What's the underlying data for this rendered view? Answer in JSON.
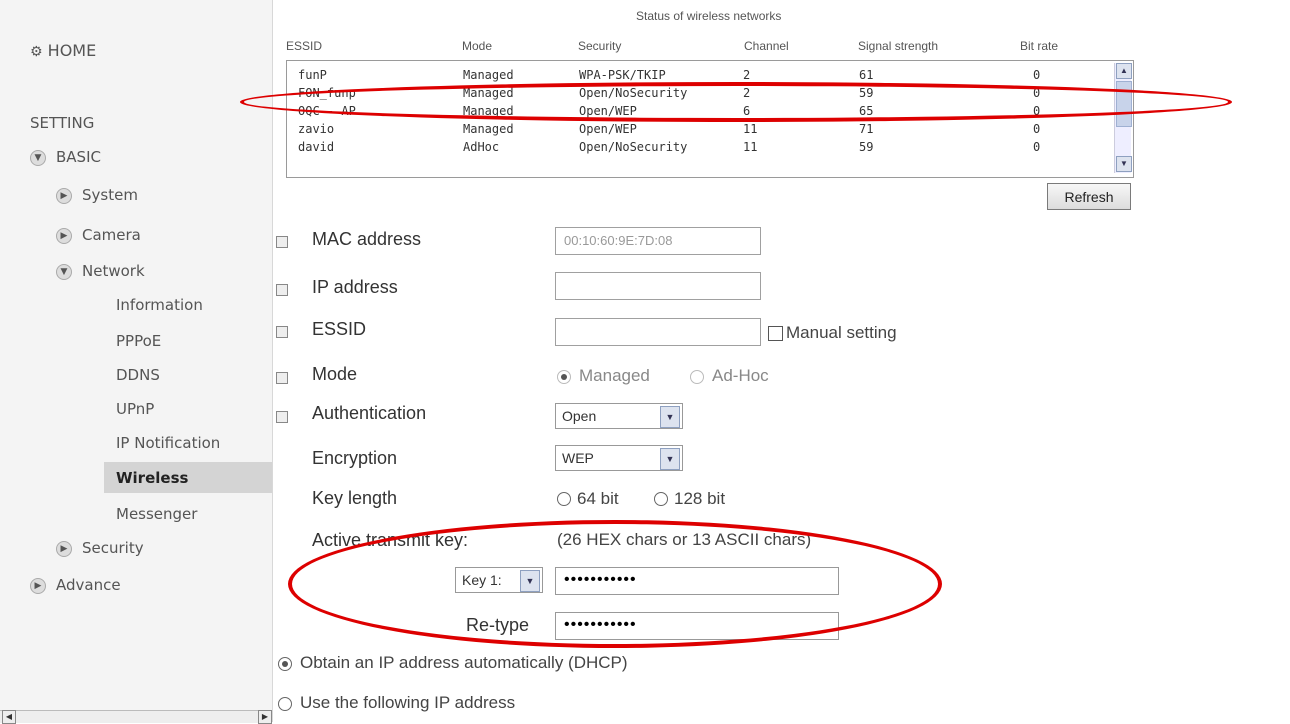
{
  "sidebar": {
    "home": "HOME",
    "setting": "SETTING",
    "basic": "BASIC",
    "system": "System",
    "camera": "Camera",
    "network": "Network",
    "network_items": [
      "Information",
      "PPPoE",
      "DDNS",
      "UPnP",
      "IP Notification",
      "Wireless",
      "Messenger"
    ],
    "security": "Security",
    "advance": "Advance"
  },
  "status": {
    "title": "Status of wireless networks",
    "columns": [
      "ESSID",
      "Mode",
      "Security",
      "Channel",
      "Signal strength",
      "Bit rate"
    ],
    "rows": [
      [
        "funP",
        "Managed",
        "WPA-PSK/TKIP",
        "2",
        "61",
        "0"
      ],
      [
        "FON_funp",
        "Managed",
        "Open/NoSecurity",
        "2",
        "59",
        "0"
      ],
      [
        "OQC - AP",
        "Managed",
        "Open/WEP",
        "6",
        "65",
        "0"
      ],
      [
        "zavio",
        "Managed",
        "Open/WEP",
        "11",
        "71",
        "0"
      ],
      [
        "david",
        "AdHoc",
        "Open/NoSecurity",
        "11",
        "59",
        "0"
      ]
    ],
    "refresh": "Refresh"
  },
  "form": {
    "mac_label": "MAC address",
    "mac_value": "00:10:60:9E:7D:08",
    "ip_label": "IP address",
    "ip_value": "",
    "essid_label": "ESSID",
    "essid_value": "",
    "manual_setting": "Manual setting",
    "mode_label": "Mode",
    "mode_managed": "Managed",
    "mode_adhoc": "Ad-Hoc",
    "auth_label": "Authentication",
    "auth_value": "Open",
    "enc_label": "Encryption",
    "enc_value": "WEP",
    "keylen_label": "Key length",
    "keylen_64": "64 bit",
    "keylen_128": "128 bit",
    "active_key_label": "Active transmit key:",
    "active_key_hint": "(26 HEX chars or 13 ASCII chars)",
    "key_select": "Key 1:",
    "key_value": "•••••••••••",
    "retype_label": "Re-type",
    "retype_value": "•••••••••••",
    "dhcp_option": "Obtain an IP address automatically (DHCP)",
    "static_option": "Use the following IP address"
  }
}
